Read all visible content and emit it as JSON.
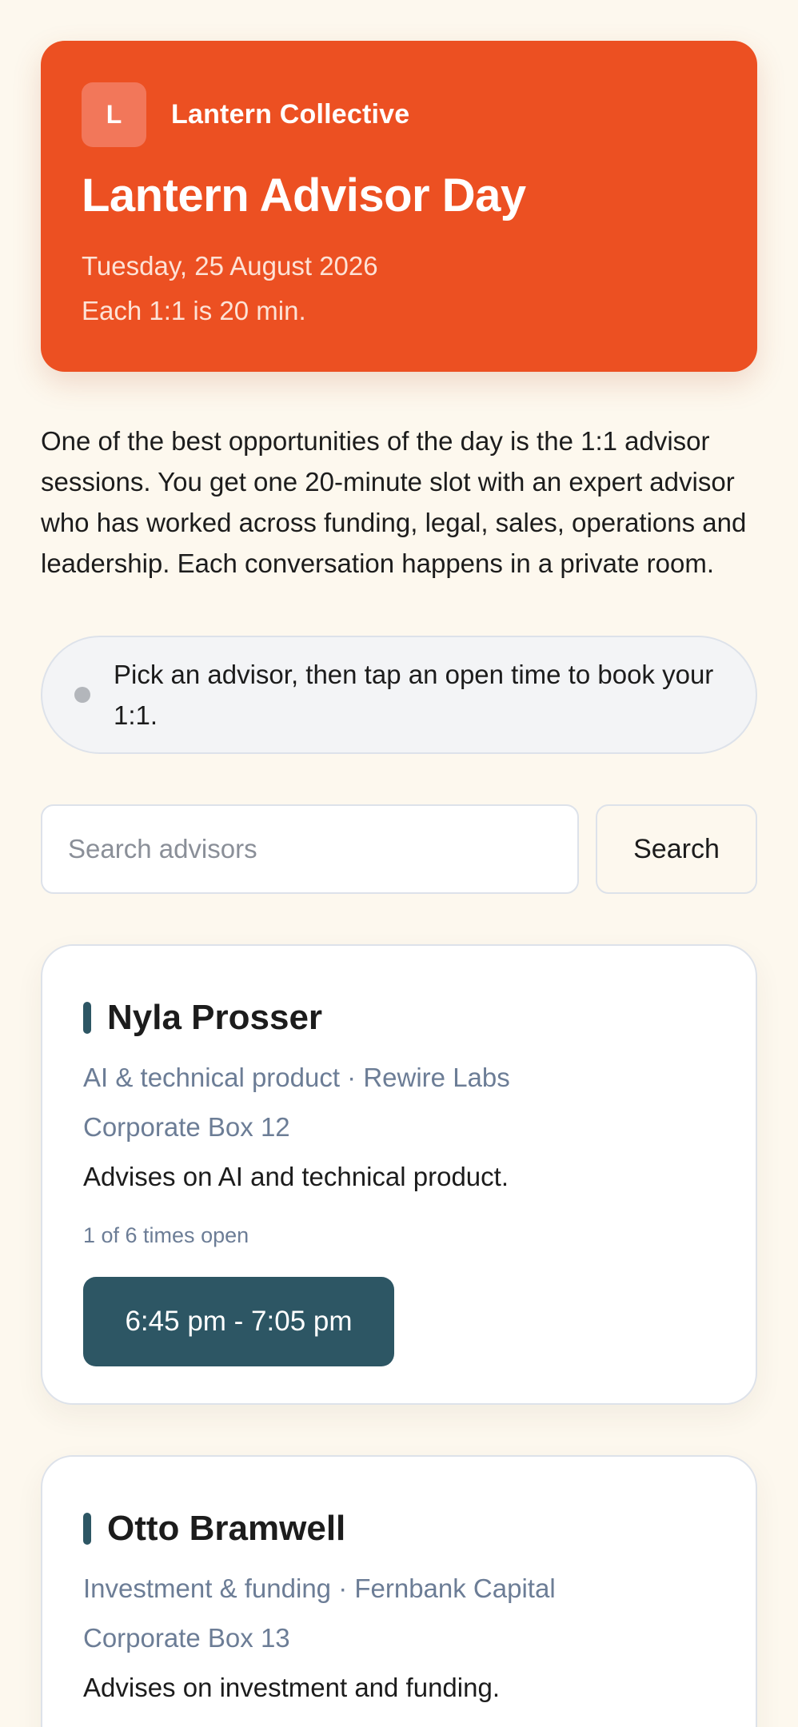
{
  "header": {
    "logo_letter": "L",
    "org_name": "Lantern Collective",
    "title": "Lantern Advisor Day",
    "date": "Tuesday, 25 August 2026",
    "duration": "Each 1:1 is 20 min.",
    "accent_color": "#ec5022"
  },
  "intro": "One of the best opportunities of the day is the 1:1 advisor sessions. You get one 20-minute slot with an expert advisor who has worked across funding, legal, sales, operations and leadership. Each conversation happens in a private room.",
  "hint": {
    "icon": "status-dot-icon",
    "text": "Pick an advisor, then tap an open time to book your 1:1."
  },
  "search": {
    "placeholder": "Search advisors",
    "value": "",
    "button_label": "Search"
  },
  "advisors": [
    {
      "name": "Nyla Prosser",
      "focus_company": "AI & technical product · Rewire Labs",
      "location": "Corporate Box 12",
      "description": "Advises on AI and technical product.",
      "availability": "1 of 6 times open",
      "slots": [
        "6:45 pm - 7:05 pm"
      ]
    },
    {
      "name": "Otto Bramwell",
      "focus_company": "Investment & funding · Fernbank Capital",
      "location": "Corporate Box 13",
      "description": "Advises on investment and funding."
    }
  ],
  "colors": {
    "background": "#fdf8ee",
    "slot_button": "#2d5664",
    "muted_text": "#6c7d96"
  }
}
